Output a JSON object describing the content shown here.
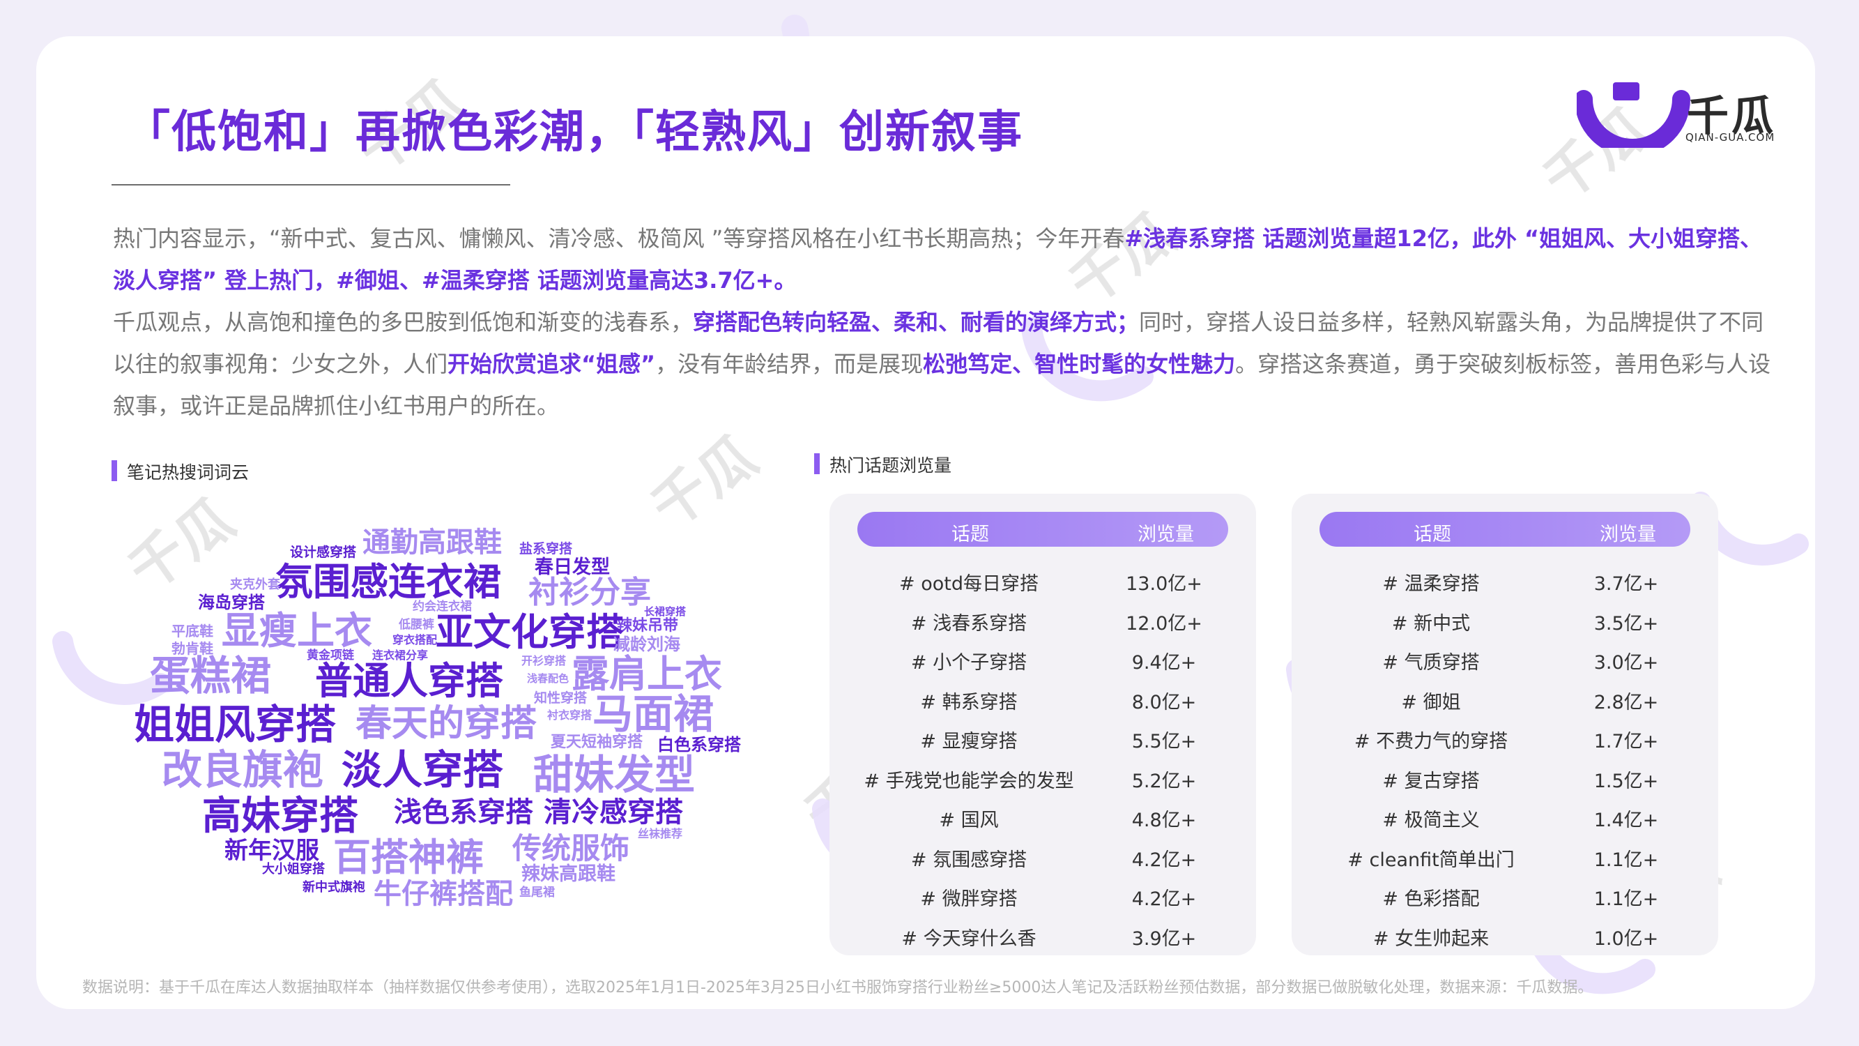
{
  "title": "「低饱和」再掀色彩潮，「轻熟风」创新叙事",
  "logo": {
    "name": "千瓜",
    "sub": "QIAN-GUA.COM"
  },
  "paragraph1": [
    {
      "t": "热门内容显示，“新中式、复古风、慵懒风、清冷感、极简风 ”等穿搭风格在小红书长期高热；今年开春",
      "h": false
    },
    {
      "t": "#浅春系穿搭 话题浏览量超12亿，此外 “姐姐风、大小姐穿搭、淡人穿搭” 登上热门，#御姐、#温柔穿搭 话题浏览量高达3.7亿+。",
      "h": true
    }
  ],
  "paragraph2": [
    {
      "t": "千瓜观点，从高饱和撞色的多巴胺到低饱和渐变的浅春系，",
      "h": false
    },
    {
      "t": "穿搭配色转向轻盈、柔和、耐看的演绎方式；",
      "h": true
    },
    {
      "t": "同时，穿搭人设日益多样，轻熟风崭露头角，为品牌提供了不同以往的叙事视角：少女之外，人们",
      "h": false
    },
    {
      "t": "开始欣赏追求“姐感”",
      "h": true
    },
    {
      "t": "，没有年龄结界，而是展现",
      "h": false
    },
    {
      "t": "松弛笃定、智性时髦的女性魅力",
      "h": true
    },
    {
      "t": "。穿搭这条赛道，勇于突破刻板标签，善用色彩与人设叙事，或许正是品牌抓住小红书用户的所在。",
      "h": false
    }
  ],
  "cloud_title": "笔记热搜词词云",
  "cloud_words": [
    "通勤高跟鞋",
    "盐系穿搭",
    "设计感穿搭",
    "春日发型",
    "氛围感连衣裙",
    "夹克外套",
    "海岛穿搭",
    "衬衫分享",
    "长裙穿搭",
    "约会连衣裙",
    "辣妹吊带",
    "显瘦上衣",
    "亚文化穿搭",
    "平底鞋",
    "低腰裤",
    "减龄刘海",
    "勃肯鞋",
    "穿衣搭配",
    "黄金项链",
    "连衣裙分享",
    "开衫穿搭",
    "蛋糕裙",
    "普通人穿搭",
    "露肩上衣",
    "浅春配色",
    "知性穿搭",
    "姐姐风穿搭",
    "春天的穿搭",
    "马面裙",
    "衬衣穿搭",
    "夏天短袖穿搭",
    "白色系穿搭",
    "改良旗袍",
    "淡人穿搭",
    "甜妹发型",
    "高妹穿搭",
    "浅色系穿搭",
    "清冷感穿搭",
    "新年汉服",
    "百搭神裤",
    "传统服饰",
    "丝袜推荐",
    "大小姐穿搭",
    "辣妹高跟鞋",
    "新中式旗袍",
    "牛仔裤搭配",
    "鱼尾裙"
  ],
  "table_title": "热门话题浏览量",
  "table_headers": {
    "topic": "话题",
    "views": "浏览量"
  },
  "table_left": [
    {
      "topic": "# ootd每日穿搭",
      "views": "13.0亿+"
    },
    {
      "topic": "# 浅春系穿搭",
      "views": "12.0亿+"
    },
    {
      "topic": "# 小个子穿搭",
      "views": "9.4亿+"
    },
    {
      "topic": "# 韩系穿搭",
      "views": "8.0亿+"
    },
    {
      "topic": "# 显瘦穿搭",
      "views": "5.5亿+"
    },
    {
      "topic": "# 手残党也能学会的发型",
      "views": "5.2亿+"
    },
    {
      "topic": "# 国风",
      "views": "4.8亿+"
    },
    {
      "topic": "# 氛围感穿搭",
      "views": "4.2亿+"
    },
    {
      "topic": "# 微胖穿搭",
      "views": "4.2亿+"
    },
    {
      "topic": "# 今天穿什么香",
      "views": "3.9亿+"
    }
  ],
  "table_right": [
    {
      "topic": "# 温柔穿搭",
      "views": "3.7亿+"
    },
    {
      "topic": "# 新中式",
      "views": "3.5亿+"
    },
    {
      "topic": "# 气质穿搭",
      "views": "3.0亿+"
    },
    {
      "topic": "# 御姐",
      "views": "2.8亿+"
    },
    {
      "topic": "# 不费力气的穿搭",
      "views": "1.7亿+"
    },
    {
      "topic": "# 复古穿搭",
      "views": "1.5亿+"
    },
    {
      "topic": "# 极简主义",
      "views": "1.4亿+"
    },
    {
      "topic": "# cleanfit简单出门",
      "views": "1.1亿+"
    },
    {
      "topic": "# 色彩搭配",
      "views": "1.1亿+"
    },
    {
      "topic": "# 女生帅起来",
      "views": "1.0亿+"
    }
  ],
  "footnote": "数据说明：基于千瓜在库达人数据抽取样本（抽样数据仅供参考使用），选取2025年1月1日-2025年3月25日小红书服饰穿搭行业粉丝≥5000达人笔记及活跃粉丝预估数据，部分数据已做脱敏化处理，数据来源：千瓜数据。",
  "colors": {
    "accent": "#6a2bd8",
    "highlight": "#6a32e0",
    "deep": "#5a1fd0",
    "mid": "#7a4ae6",
    "light": "#a68af0"
  }
}
